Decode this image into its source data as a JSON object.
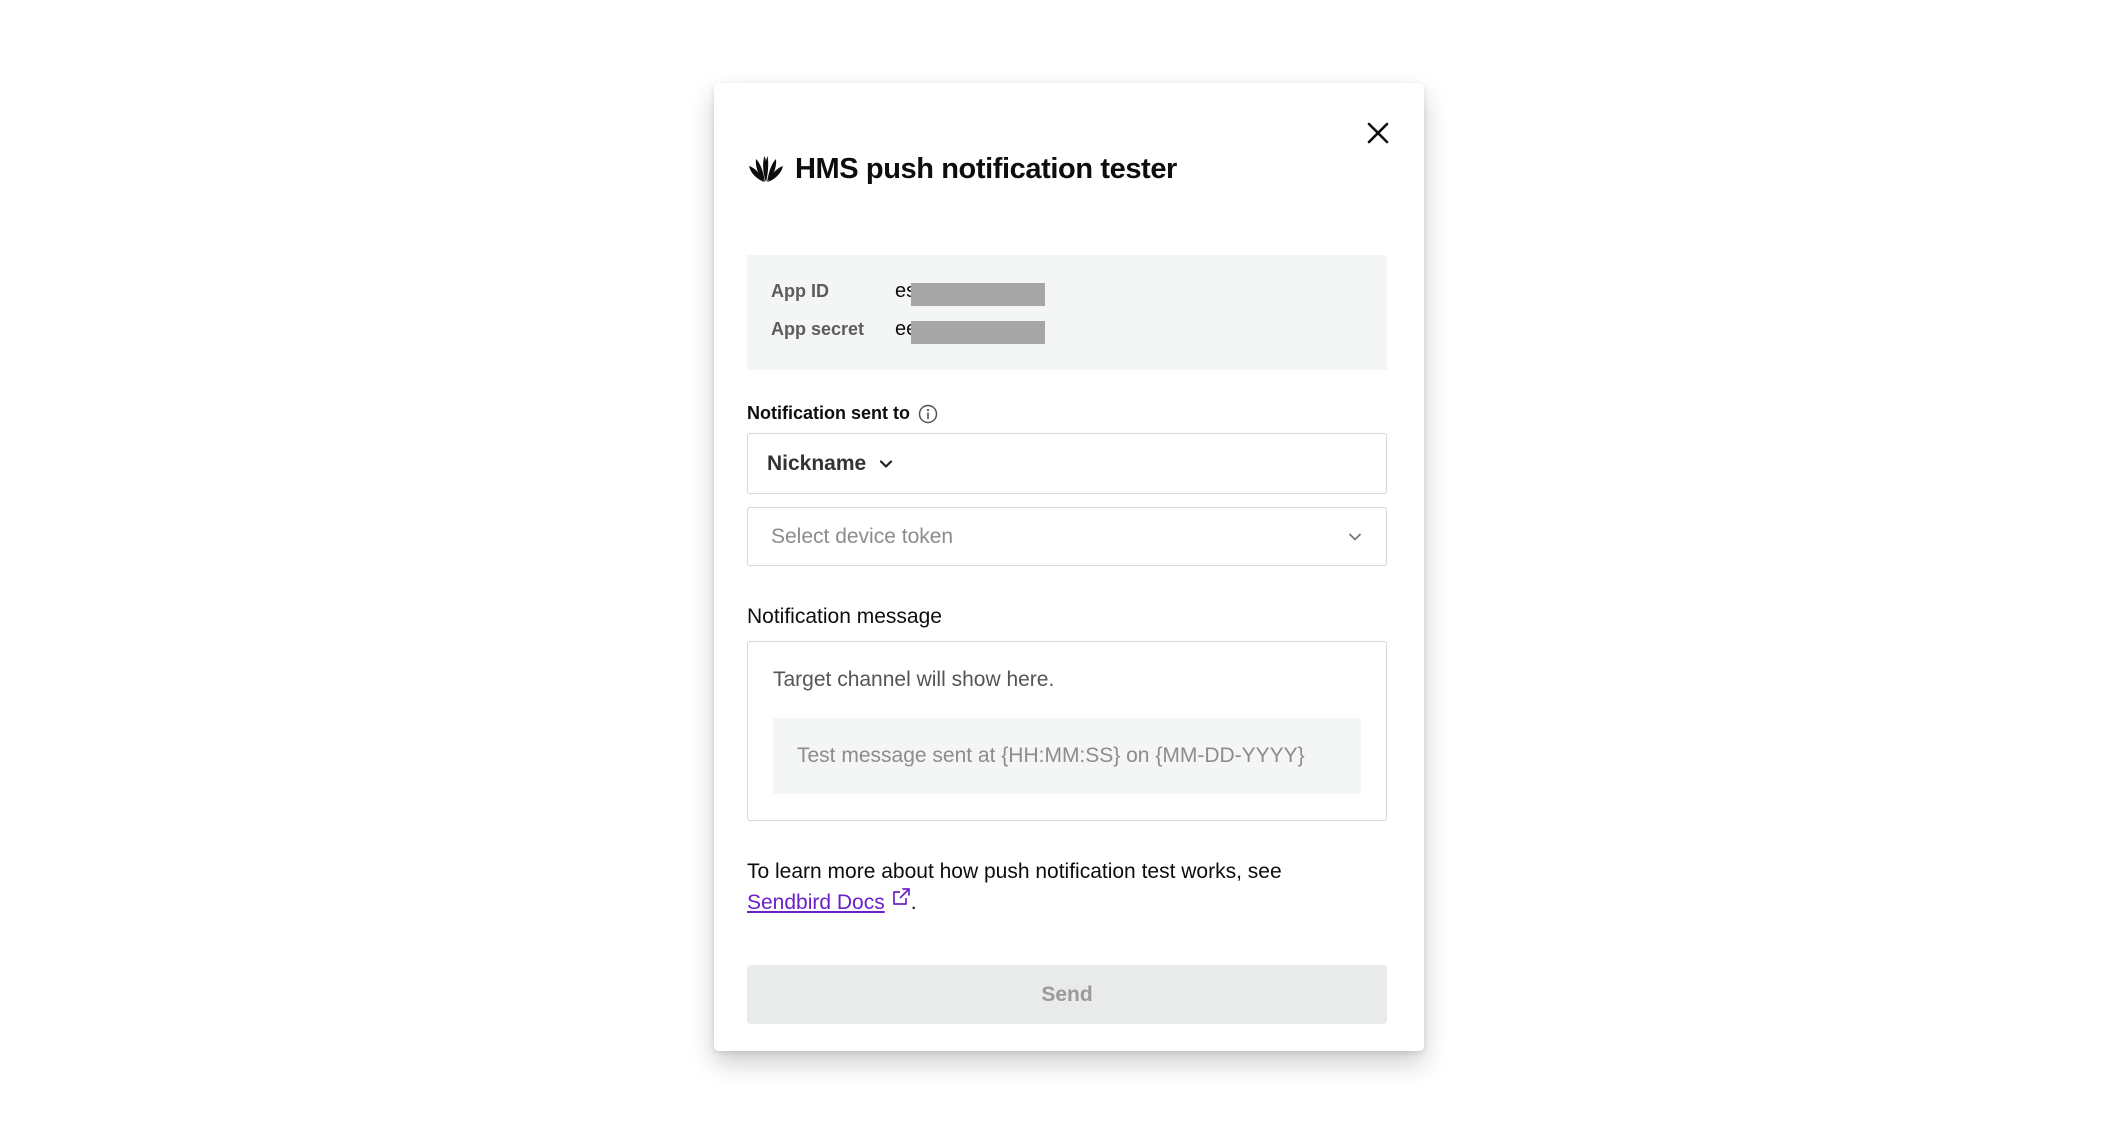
{
  "dialog": {
    "title": "HMS push notification tester",
    "logo_icon": "huawei-logo-icon",
    "close_icon": "close-icon"
  },
  "credentials": {
    "app_id_label": "App ID",
    "app_id_value": "es",
    "app_secret_label": "App secret",
    "app_secret_value": "ee",
    "redaction_color": "#a6a6a6"
  },
  "recipient": {
    "label": "Notification sent to",
    "info_icon": "info-icon",
    "type_selected": "Nickname",
    "token_placeholder": "Select device token"
  },
  "message": {
    "label": "Notification message",
    "channel_text": "Target channel will show here.",
    "preview_text": "Test message sent at {HH:MM:SS} on {MM-DD-YYYY}"
  },
  "help": {
    "text": "To learn more about how push notification test works, see",
    "link_label": "Sendbird Docs",
    "link_icon": "external-link-icon",
    "suffix": ".",
    "link_color": "#6b21c8"
  },
  "actions": {
    "send_label": "Send",
    "send_disabled": true
  }
}
